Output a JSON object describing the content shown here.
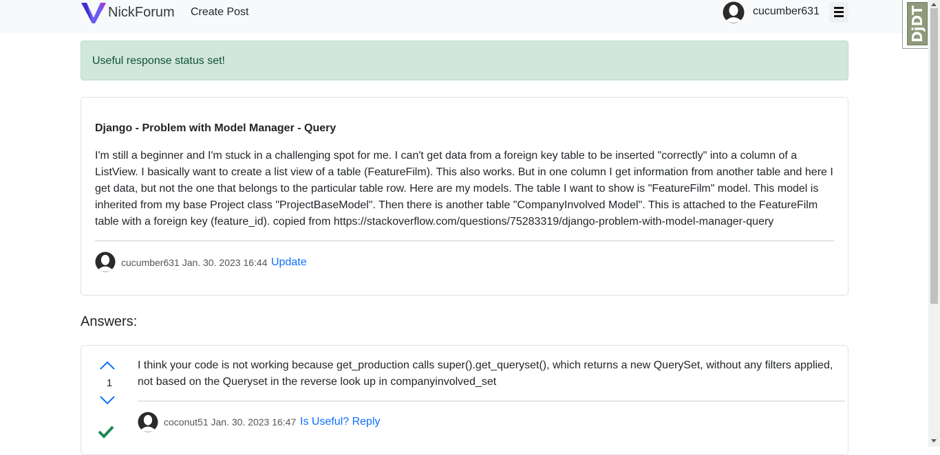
{
  "navbar": {
    "brand": "NickForum",
    "create_post": "Create Post",
    "username": "cucumber631"
  },
  "djdt": {
    "label": "DjDT"
  },
  "alert": {
    "message": "Useful response status set!"
  },
  "question": {
    "title": "Django - Problem with Model Manager - Query",
    "body": "I'm still a beginner and I'm stuck in a challenging spot for me. I can't get data from a foreign key table to be inserted \"correctly\" into a column of a ListView. I basically want to create a list view of a table (FeatureFilm). This also works. But in one column I get information from another table and here I get data, but not the one that belongs to the particular table row. Here are my models. The table I want to show is \"FeatureFilm\" model. This model is inherited from my base Project class \"ProjectBaseModel\". Then there is another table \"CompanyInvolved Model\". This is attached to the FeatureFilm table with a foreign key (feature_id). copied from https://stackoverflow.com/questions/75283319/django-problem-with-model-manager-query",
    "author": "cucumber631",
    "date": "Jan. 30. 2023 16:44",
    "update_label": "Update"
  },
  "answers_heading": "Answers:",
  "answers": [
    {
      "votes": "1",
      "body": "I think your code is not working because get_production calls super().get_queryset(), which returns a new QuerySet, without any filters applied, not based on the Queryset in the reverse look up in companyinvolved_set",
      "author": "coconut51",
      "date": "Jan. 30. 2023 16:47",
      "useful_label": "Is Useful?",
      "reply_label": "Reply"
    }
  ],
  "colors": {
    "link": "#0d6efd",
    "alert_bg": "#d1e7dd",
    "alert_text": "#0f5132",
    "accepted": "#198754"
  }
}
